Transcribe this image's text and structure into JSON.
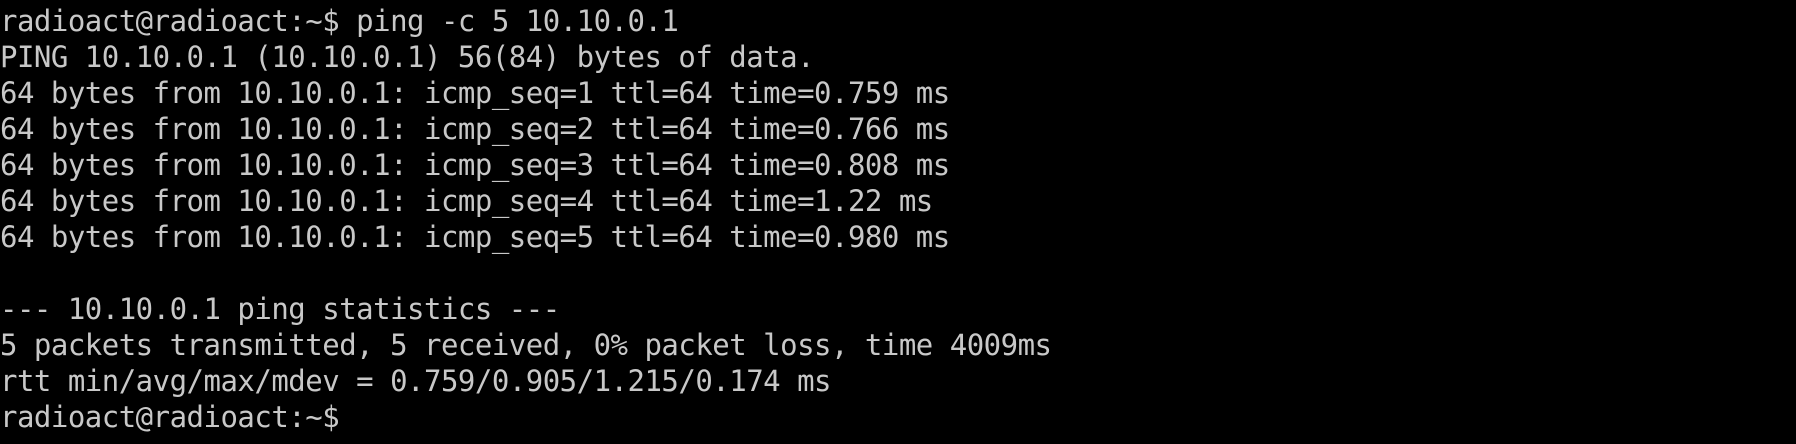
{
  "terminal": {
    "colors": {
      "background": "#000000",
      "foreground": "#c8c8c8"
    },
    "lines": [
      "radioact@radioact:~$ ping -c 5 10.10.0.1",
      "PING 10.10.0.1 (10.10.0.1) 56(84) bytes of data.",
      "64 bytes from 10.10.0.1: icmp_seq=1 ttl=64 time=0.759 ms",
      "64 bytes from 10.10.0.1: icmp_seq=2 ttl=64 time=0.766 ms",
      "64 bytes from 10.10.0.1: icmp_seq=3 ttl=64 time=0.808 ms",
      "64 bytes from 10.10.0.1: icmp_seq=4 ttl=64 time=1.22 ms",
      "64 bytes from 10.10.0.1: icmp_seq=5 ttl=64 time=0.980 ms",
      "",
      "--- 10.10.0.1 ping statistics ---",
      "5 packets transmitted, 5 received, 0% packet loss, time 4009ms",
      "rtt min/avg/max/mdev = 0.759/0.905/1.215/0.174 ms",
      "radioact@radioact:~$"
    ]
  }
}
